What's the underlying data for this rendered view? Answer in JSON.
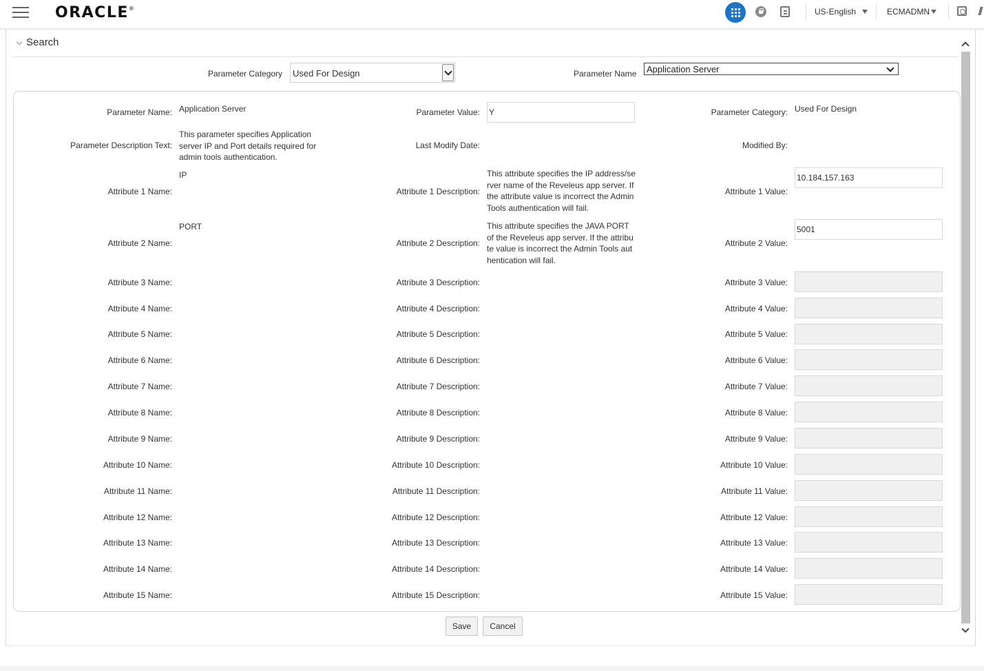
{
  "header": {
    "logo": "ORACLE",
    "language": "US-English",
    "user": "ECMADMN"
  },
  "search": {
    "title": "Search",
    "category_label": "Parameter Category",
    "category_value": "Used For Design",
    "name_label": "Parameter Name",
    "name_value": "Application Server"
  },
  "form": {
    "param_name_label": "Parameter Name:",
    "param_name_value": "Application Server",
    "param_value_label": "Parameter Value:",
    "param_value_value": "Y",
    "param_category_label": "Parameter Category:",
    "param_category_value": "Used For Design",
    "desc_label": "Parameter Description Text:",
    "desc_value": "This parameter specifies  Application server IP and Port details required for admin tools authentication.",
    "last_modify_label": "Last Modify Date:",
    "modified_by_label": "Modified By:",
    "attributes": [
      {
        "name_label": "Attribute 1 Name:",
        "name_value": "IP",
        "desc_label": "Attribute 1 Description:",
        "desc_value": "This attribute specifies the IP address/server name of the Reveleus app server. If the attribute value is incorrect the Admin Tools authentication will fail.",
        "value_label": "Attribute 1 Value:",
        "value": "10.184.157.163"
      },
      {
        "name_label": "Attribute 2 Name:",
        "name_value": "PORT",
        "desc_label": "Attribute 2 Description:",
        "desc_value": "This attribute specifies the JAVA PORT of the Reveleus app server. If the attribute value is incorrect the Admin Tools authentication will fail.",
        "value_label": "Attribute 2 Value:",
        "value": "5001"
      },
      {
        "name_label": "Attribute 3 Name:",
        "desc_label": "Attribute 3 Description:",
        "value_label": "Attribute 3 Value:"
      },
      {
        "name_label": "Attribute 4 Name:",
        "desc_label": "Attribute 4 Description:",
        "value_label": "Attribute 4 Value:"
      },
      {
        "name_label": "Attribute 5 Name:",
        "desc_label": "Attribute 5 Description:",
        "value_label": "Attribute 5 Value:"
      },
      {
        "name_label": "Attribute 6 Name:",
        "desc_label": "Attribute 6 Description:",
        "value_label": "Attribute 6 Value:"
      },
      {
        "name_label": "Attribute 7 Name:",
        "desc_label": "Attribute 7 Description:",
        "value_label": "Attribute 7 Value:"
      },
      {
        "name_label": "Attribute 8 Name:",
        "desc_label": "Attribute 8 Description:",
        "value_label": "Attribute 8 Value:"
      },
      {
        "name_label": "Attribute 9 Name:",
        "desc_label": "Attribute 9 Description:",
        "value_label": "Attribute 9 Value:"
      },
      {
        "name_label": "Attribute 10 Name:",
        "desc_label": "Attribute 10 Description:",
        "value_label": "Attribute 10 Value:"
      },
      {
        "name_label": "Attribute 11 Name:",
        "desc_label": "Attribute 11 Description:",
        "value_label": "Attribute 11 Value:"
      },
      {
        "name_label": "Attribute 12 Name:",
        "desc_label": "Attribute 12 Description:",
        "value_label": "Attribute 12 Value:"
      },
      {
        "name_label": "Attribute 13 Name:",
        "desc_label": "Attribute 13 Description:",
        "value_label": "Attribute 13 Value:"
      },
      {
        "name_label": "Attribute 14 Name:",
        "desc_label": "Attribute 14 Description:",
        "value_label": "Attribute 14 Value:"
      },
      {
        "name_label": "Attribute 15 Name:",
        "desc_label": "Attribute 15 Description:",
        "value_label": "Attribute 15 Value:"
      }
    ]
  },
  "actions": {
    "save": "Save",
    "cancel": "Cancel"
  },
  "colors": {
    "accent": "#1a74c9",
    "disabled_field": "#f0f0f0"
  }
}
